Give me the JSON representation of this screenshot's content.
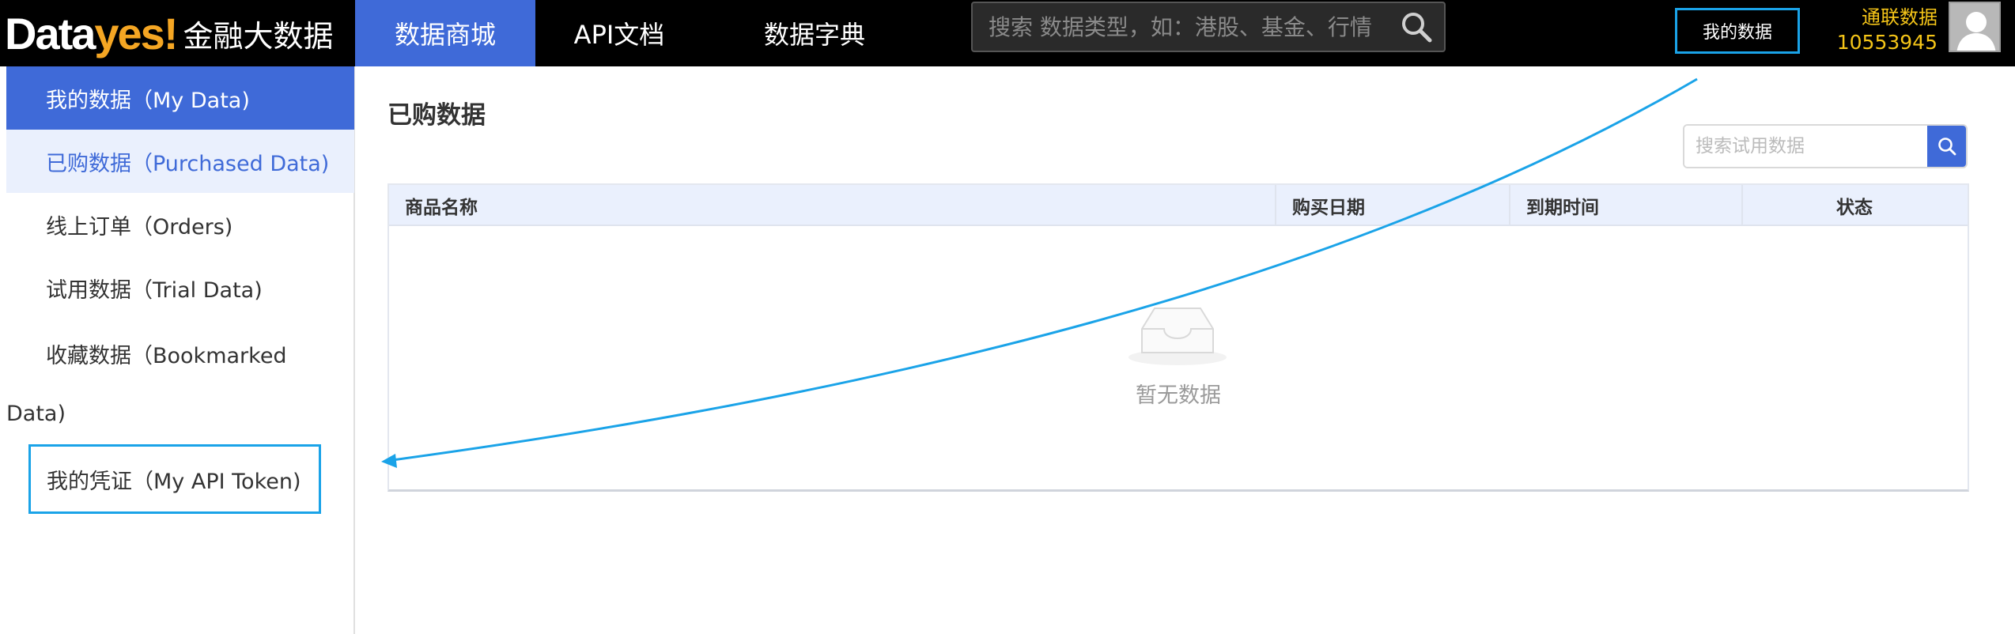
{
  "header": {
    "logo_data": "Data",
    "logo_yes": "yes!",
    "logo_sub": "金融大数据",
    "nav": [
      {
        "label": "数据商城"
      },
      {
        "label": "API文档"
      },
      {
        "label": "数据字典"
      }
    ],
    "search_placeholder": "搜索 数据类型，如：港股、基金、行情",
    "my_data_label": "我的数据",
    "org_name": "通联数据",
    "user_id": "10553945"
  },
  "sidebar": {
    "items": [
      {
        "label": "我的数据（My Data)"
      },
      {
        "label": "已购数据（Purchased Data)"
      },
      {
        "label": "线上订单（Orders)"
      },
      {
        "label": "试用数据（Trial Data)"
      }
    ],
    "bookmarked_line1": "收藏数据（Bookmarked",
    "bookmarked_line2": "Data)",
    "token_label": "我的凭证（My API Token)"
  },
  "main": {
    "title": "已购数据",
    "trial_search_placeholder": "搜索试用数据",
    "columns": [
      "商品名称",
      "购买日期",
      "到期时间",
      "状态"
    ],
    "empty_text": "暂无数据"
  },
  "colors": {
    "accent": "#3f6ad8",
    "highlight_box": "#1aa3e8",
    "topbar_bg": "#000000",
    "brand_yellow": "#f5a623"
  }
}
